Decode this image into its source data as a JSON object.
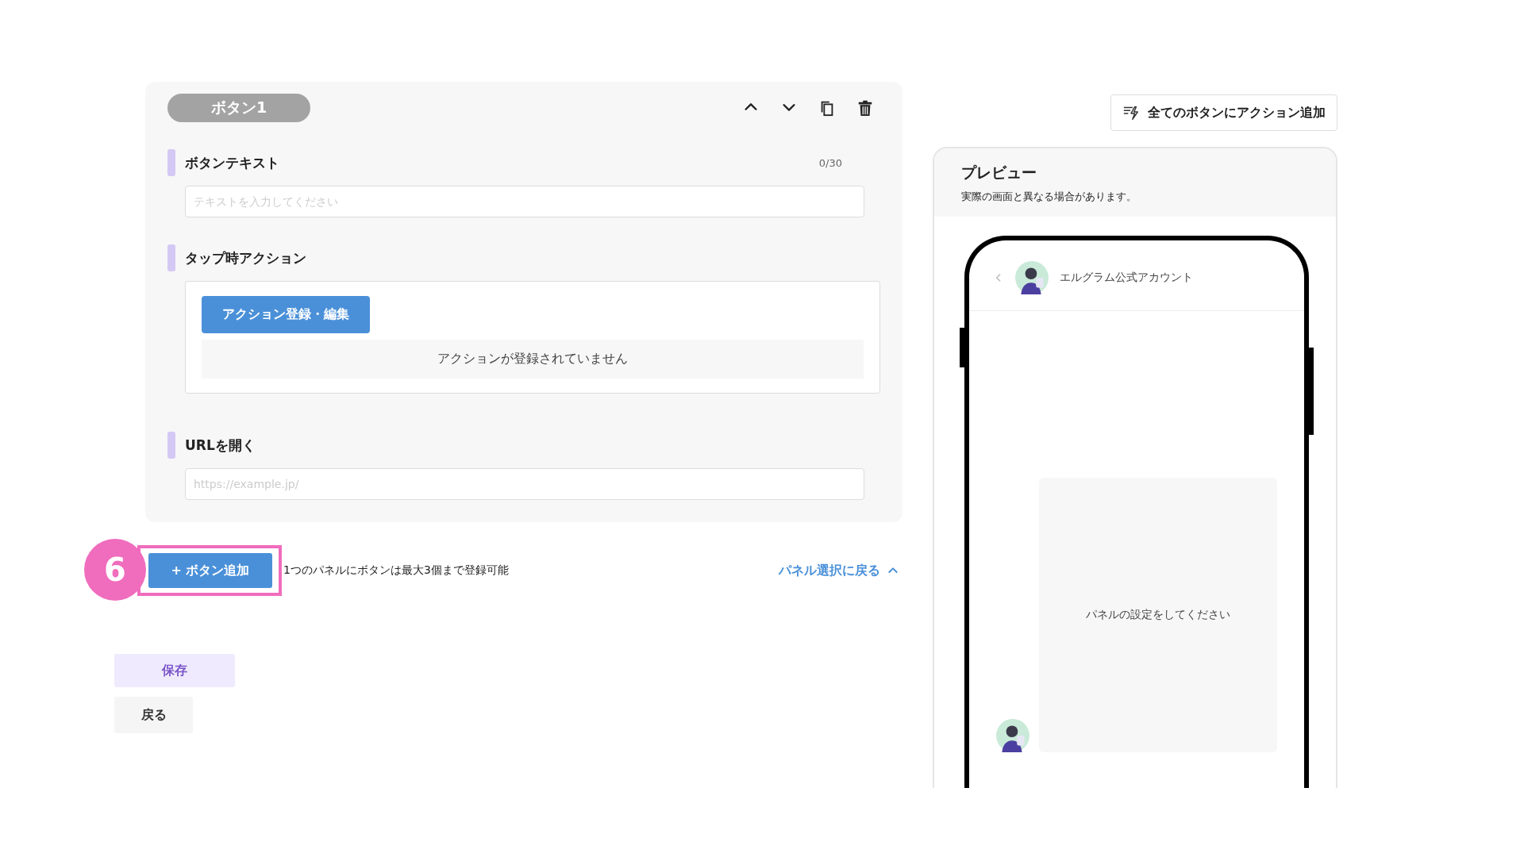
{
  "editor": {
    "title": "ボタン1",
    "fields": [
      {
        "kind": "text",
        "label": "ボタンテキスト",
        "counter": "0/30",
        "placeholder": "テキストを入力してください"
      },
      {
        "kind": "action",
        "label": "タップ時アクション",
        "button": "アクション登録・編集",
        "empty_message": "アクションが登録されていません"
      },
      {
        "kind": "text",
        "label": "URLを開く",
        "placeholder": "https://example.jp/"
      }
    ]
  },
  "step_badge": "6",
  "add_button": {
    "label": "+ ボタン追加",
    "highlighted": true
  },
  "limit_note": "1つのパネルにボタンは最大3個まで登録可能",
  "back_to_panels": "パネル選択に戻る",
  "save_button": "保存",
  "back_button": "戻る",
  "bulk_action_button": "全てのボタンにアクション追加",
  "preview": {
    "title": "プレビュー",
    "note": "実際の画面と異なる場合があります。",
    "account_name": "エルグラム公式アカウント",
    "placeholder_message": "パネルの設定をしてください"
  }
}
